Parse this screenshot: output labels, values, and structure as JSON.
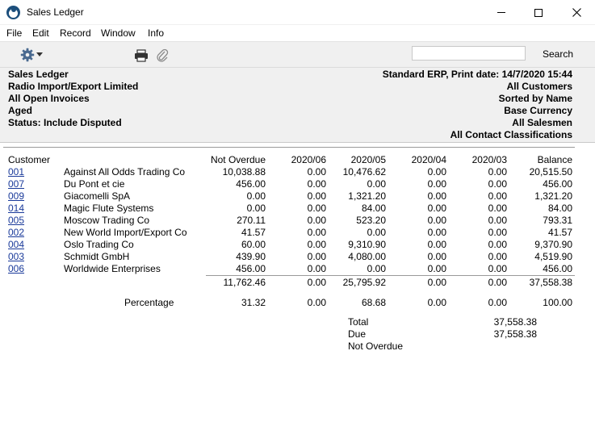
{
  "window": {
    "title": "Sales Ledger"
  },
  "menu": [
    "File",
    "Edit",
    "Record",
    "Window",
    "Info"
  ],
  "toolbar": {
    "search_label": "Search",
    "search_value": ""
  },
  "report_header": {
    "left": [
      "Sales Ledger",
      "Radio Import/Export Limited",
      "All Open Invoices",
      "Aged",
      "Status: Include Disputed"
    ],
    "right": [
      "Standard ERP, Print date: 14/7/2020 15:44",
      "All Customers",
      "Sorted by Name",
      "Base Currency",
      "All Salesmen",
      "All Contact Classifications"
    ]
  },
  "columns": [
    "Customer",
    "Not Overdue",
    "2020/06",
    "2020/05",
    "2020/04",
    "2020/03",
    "Balance"
  ],
  "rows": [
    {
      "code": "001",
      "name": "Against All Odds Trading Co",
      "values": [
        "10,038.88",
        "0.00",
        "10,476.62",
        "0.00",
        "0.00",
        "20,515.50"
      ]
    },
    {
      "code": "007",
      "name": "Du Pont et cie",
      "values": [
        "456.00",
        "0.00",
        "0.00",
        "0.00",
        "0.00",
        "456.00"
      ]
    },
    {
      "code": "009",
      "name": "Giacomelli SpA",
      "values": [
        "0.00",
        "0.00",
        "1,321.20",
        "0.00",
        "0.00",
        "1,321.20"
      ]
    },
    {
      "code": "014",
      "name": "Magic Flute Systems",
      "values": [
        "0.00",
        "0.00",
        "84.00",
        "0.00",
        "0.00",
        "84.00"
      ]
    },
    {
      "code": "005",
      "name": "Moscow Trading Co",
      "values": [
        "270.11",
        "0.00",
        "523.20",
        "0.00",
        "0.00",
        "793.31"
      ]
    },
    {
      "code": "002",
      "name": "New World Import/Export Co",
      "values": [
        "41.57",
        "0.00",
        "0.00",
        "0.00",
        "0.00",
        "41.57"
      ]
    },
    {
      "code": "004",
      "name": "Oslo Trading Co",
      "values": [
        "60.00",
        "0.00",
        "9,310.90",
        "0.00",
        "0.00",
        "9,370.90"
      ]
    },
    {
      "code": "003",
      "name": "Schmidt GmbH",
      "values": [
        "439.90",
        "0.00",
        "4,080.00",
        "0.00",
        "0.00",
        "4,519.90"
      ]
    },
    {
      "code": "006",
      "name": "Worldwide Enterprises",
      "values": [
        "456.00",
        "0.00",
        "0.00",
        "0.00",
        "0.00",
        "456.00"
      ]
    }
  ],
  "totals": [
    "11,762.46",
    "0.00",
    "25,795.92",
    "0.00",
    "0.00",
    "37,558.38"
  ],
  "percentage": {
    "label": "Percentage",
    "values": [
      "31.32",
      "0.00",
      "68.68",
      "0.00",
      "0.00",
      "100.00"
    ]
  },
  "summary": [
    {
      "label": "Total",
      "value": "37,558.38"
    },
    {
      "label": "Due",
      "value": "37,558.38"
    },
    {
      "label": "Not Overdue",
      "value": ""
    }
  ]
}
